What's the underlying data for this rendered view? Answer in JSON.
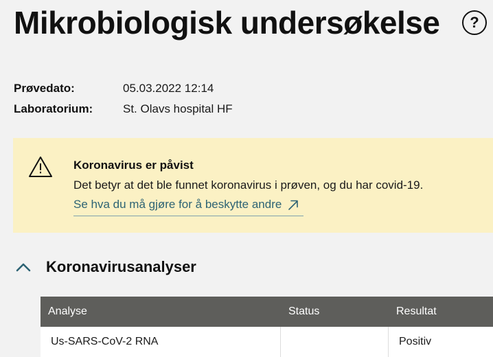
{
  "page": {
    "title": "Mikrobiologisk undersøkelse",
    "help_symbol": "?"
  },
  "meta": [
    {
      "label": "Prøvedato:",
      "value": "05.03.2022 12:14"
    },
    {
      "label": "Laboratorium:",
      "value": "St. Olavs hospital HF"
    }
  ],
  "alert": {
    "heading": "Koronavirus er påvist",
    "body": "Det betyr at det ble funnet koronavirus i prøven, og du har covid-19.",
    "link_text": "Se hva du må gjøre for å beskytte andre",
    "icon": "warning-triangle-icon",
    "background_color": "#fbf1c4"
  },
  "section": {
    "title": "Koronavirusanalyser",
    "expanded": true
  },
  "table": {
    "headers": [
      "Analyse",
      "Status",
      "Resultat"
    ],
    "rows": [
      [
        "Us-SARS-CoV-2 RNA",
        "",
        "Positiv"
      ]
    ]
  },
  "colors": {
    "header_bg": "#5e5e5b",
    "link": "#2d6374",
    "chevron": "#2d6374"
  }
}
